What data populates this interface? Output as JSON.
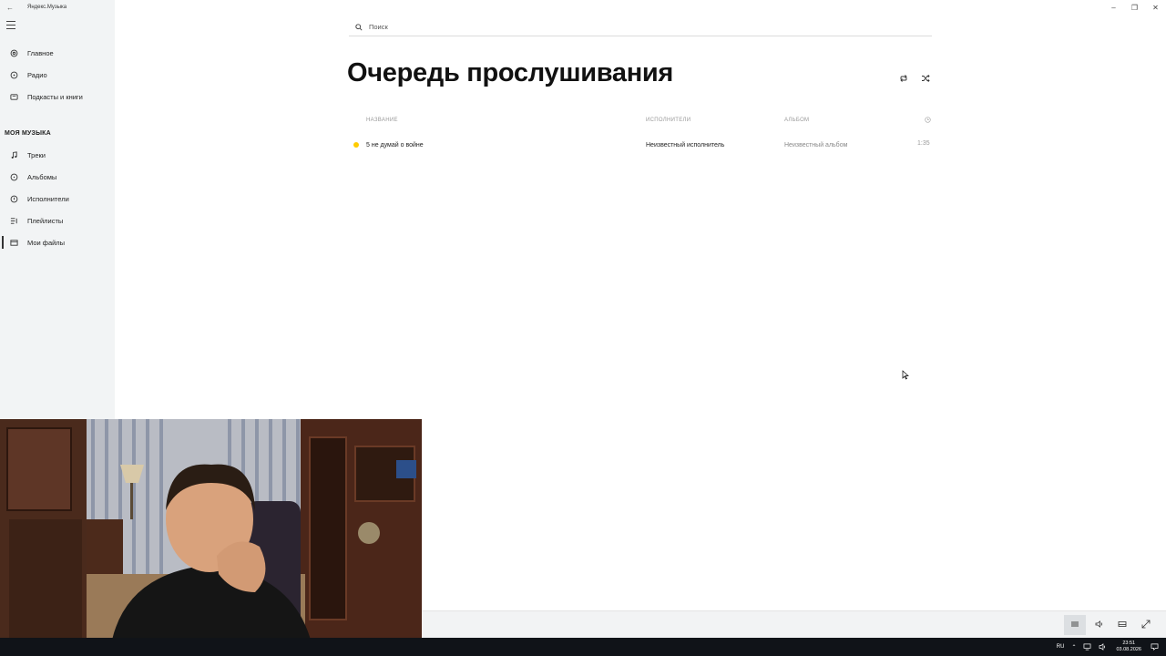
{
  "window": {
    "app_title": "Яндекс.Музыка",
    "controls": [
      "minimize",
      "restore",
      "close"
    ]
  },
  "sidebar": {
    "nav": [
      {
        "label": "Главное",
        "icon": "home-icon"
      },
      {
        "label": "Радио",
        "icon": "radio-icon"
      },
      {
        "label": "Подкасты и книги",
        "icon": "podcasts-icon"
      }
    ],
    "section_title": "МОЯ МУЗЫКА",
    "my_music": [
      {
        "label": "Треки",
        "icon": "note-icon"
      },
      {
        "label": "Альбомы",
        "icon": "album-icon"
      },
      {
        "label": "Исполнители",
        "icon": "artist-icon"
      },
      {
        "label": "Плейлисты",
        "icon": "playlist-icon"
      },
      {
        "label": "Мои файлы",
        "icon": "files-icon"
      }
    ],
    "active_item": "Мои файлы"
  },
  "search": {
    "placeholder": "Поиск",
    "value": ""
  },
  "main": {
    "title": "Очередь прослушивания",
    "actions": [
      "repeat-icon",
      "shuffle-icon"
    ],
    "table": {
      "columns": [
        "НАЗВАНИЕ",
        "ИСПОЛНИТЕЛИ",
        "АЛЬБОМ"
      ],
      "duration_column_icon": "clock-icon",
      "rows": [
        {
          "title": "5 не думай о войне",
          "artist": "Неизвестный исполнитель",
          "album": "Неизвестный альбом",
          "duration": "1:35",
          "playing": true
        }
      ]
    }
  },
  "player": {
    "buttons": [
      "queue-icon",
      "volume-icon",
      "miniplayer-icon",
      "fullscreen-icon"
    ],
    "active": "queue-icon"
  },
  "taskbar": {
    "language": "RU",
    "time": "23:51",
    "date": "03.08.2026"
  },
  "colors": {
    "accent": "#ffcc00",
    "sidebar_bg": "#f2f4f5",
    "taskbar_bg": "#101318"
  }
}
